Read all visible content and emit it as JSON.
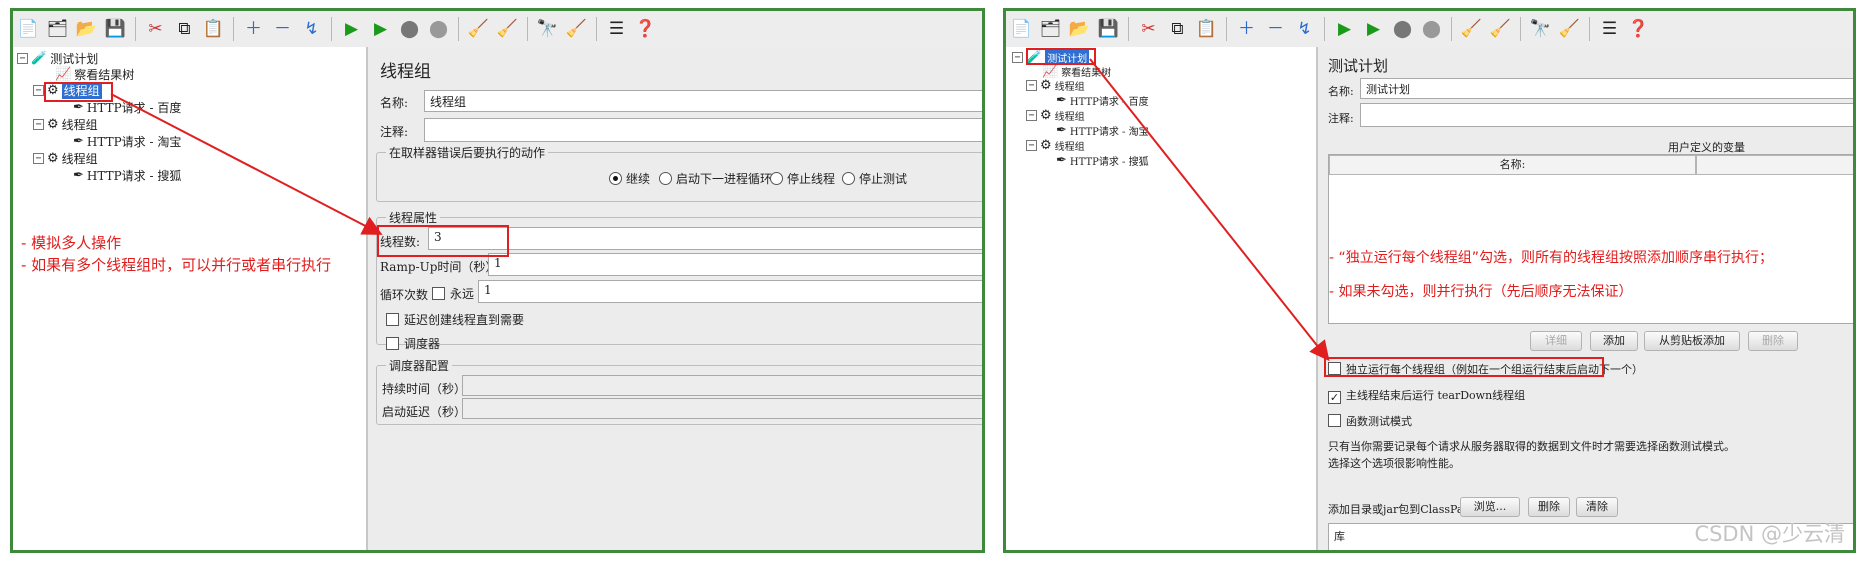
{
  "toolbar": {
    "icons": [
      "new-icon",
      "templates-icon",
      "open-icon",
      "save-icon",
      "cut-icon",
      "copy-icon",
      "paste-icon",
      "expand-icon",
      "collapse-icon",
      "toggle-icon",
      "start-icon",
      "start-no-pause-icon",
      "stop-icon",
      "shutdown-icon",
      "clear-icon",
      "clear-all-icon",
      "search-icon",
      "reset-search-icon",
      "function-helper-icon",
      "help-icon"
    ]
  },
  "left": {
    "tree": {
      "root": "测试计划",
      "listener": "察看结果树",
      "groups": [
        {
          "name": "线程组",
          "request": "HTTP请求 - 百度"
        },
        {
          "name": "线程组",
          "request": "HTTP请求 - 淘宝"
        },
        {
          "name": "线程组",
          "request": "HTTP请求 - 搜狐"
        }
      ]
    },
    "panel": {
      "title": "线程组",
      "name_label": "名称:",
      "name_value": "线程组",
      "comment_label": "注释:",
      "error_action": {
        "legend": "在取样器错误后要执行的动作",
        "options": [
          "继续",
          "启动下一进程循环",
          "停止线程",
          "停止测试"
        ],
        "selected": "继续"
      },
      "thread_props": {
        "legend": "线程属性",
        "threads_label": "线程数:",
        "threads_value": "3",
        "rampup_label": "Ramp-Up时间（秒）:",
        "rampup_value": "1",
        "loop_label": "循环次数",
        "forever_label": "永远",
        "loop_value": "1",
        "delay_label": "延迟创建线程直到需要",
        "scheduler_label": "调度器"
      },
      "scheduler": {
        "legend": "调度器配置",
        "duration_label": "持续时间（秒）",
        "startup_delay_label": "启动延迟（秒）"
      }
    },
    "annotation": [
      "- 模拟多人操作",
      "- 如果有多个线程组时，可以并行或者串行执行"
    ]
  },
  "right": {
    "tree": {
      "root": "测试计划",
      "listener": "察看结果树",
      "groups": [
        {
          "name": "线程组",
          "request": "HTTP请求 - 百度"
        },
        {
          "name": "线程组",
          "request": "HTTP请求 - 淘宝"
        },
        {
          "name": "线程组",
          "request": "HTTP请求 - 搜狐"
        }
      ]
    },
    "panel": {
      "title": "测试计划",
      "name_label": "名称:",
      "name_value": "测试计划",
      "comment_label": "注释:",
      "variables_title": "用户定义的变量",
      "table_header": "名称:",
      "buttons": {
        "detail": "详细",
        "add": "添加",
        "paste": "从剪贴板添加",
        "delete": "删除"
      },
      "serial_label": "独立运行每个线程组（例如在一个组运行结束后启动下一个）",
      "teardown_label": "主线程结束后运行 tearDown线程组",
      "functional_label": "函数测试模式",
      "note_line1": "只有当你需要记录每个请求从服务器取得的数据到文件时才需要选择函数测试模式。",
      "note_line2": "选择这个选项很影响性能。",
      "classpath_label": "添加目录或jar包到ClassPath",
      "browse": "浏览...",
      "cp_delete": "删除",
      "cp_clear": "清除",
      "library_label": "库"
    },
    "annotation": [
      "- “独立运行每个线程组”勾选，则所有的线程组按照添加顺序串行执行；",
      "- 如果未勾选，则并行执行（先后顺序无法保证）"
    ],
    "watermark": "CSDN @少云清"
  },
  "colors": {
    "frame": "#3d8a3d",
    "annotation": "#e21c1c",
    "selection": "#2f6fd1"
  }
}
